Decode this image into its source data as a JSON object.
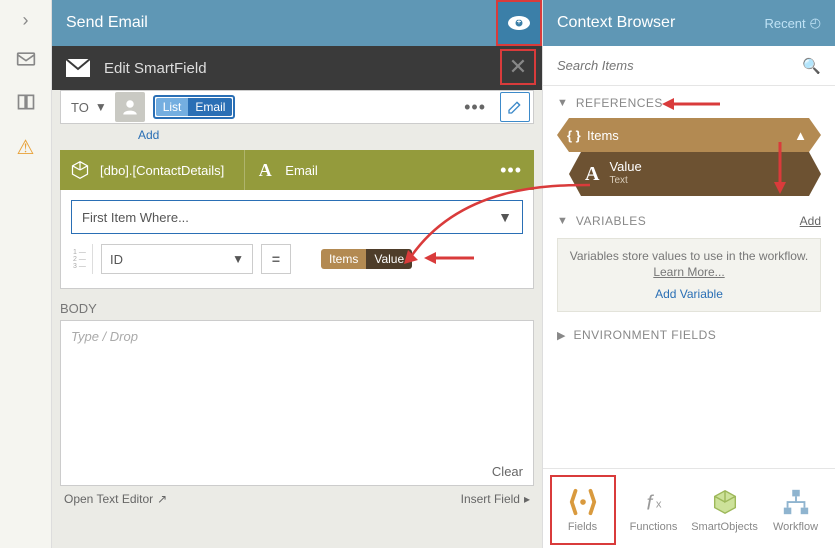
{
  "header": {
    "send_email": "Send Email",
    "context_browser": "Context Browser",
    "recent": "Recent"
  },
  "dark": {
    "title": "Edit SmartField"
  },
  "to": {
    "label": "TO",
    "pill_list": "List",
    "pill_email": "Email",
    "add": "Add"
  },
  "olive": {
    "obj": "[dbo].[ContactDetails]",
    "field": "Email"
  },
  "filter": {
    "first": "First Item Where...",
    "id": "ID",
    "eq": "=",
    "token_items": "Items",
    "token_value": "Value"
  },
  "body": {
    "label": "BODY",
    "placeholder": "Type / Drop",
    "clear": "Clear"
  },
  "footer": {
    "open": "Open Text Editor",
    "insert": "Insert Field"
  },
  "search": {
    "placeholder": "Search Items"
  },
  "refs": {
    "title": "REFERENCES",
    "items": "Items",
    "value": "Value",
    "value_type": "Text"
  },
  "vars": {
    "title": "VARIABLES",
    "add": "Add",
    "note": "Variables store values to use in the workflow.",
    "learn": "Learn More...",
    "addvar": "Add Variable"
  },
  "env": {
    "title": "ENVIRONMENT FIELDS"
  },
  "tabs": {
    "fields": "Fields",
    "functions": "Functions",
    "smartobjects": "SmartObjects",
    "workflow": "Workflow"
  }
}
